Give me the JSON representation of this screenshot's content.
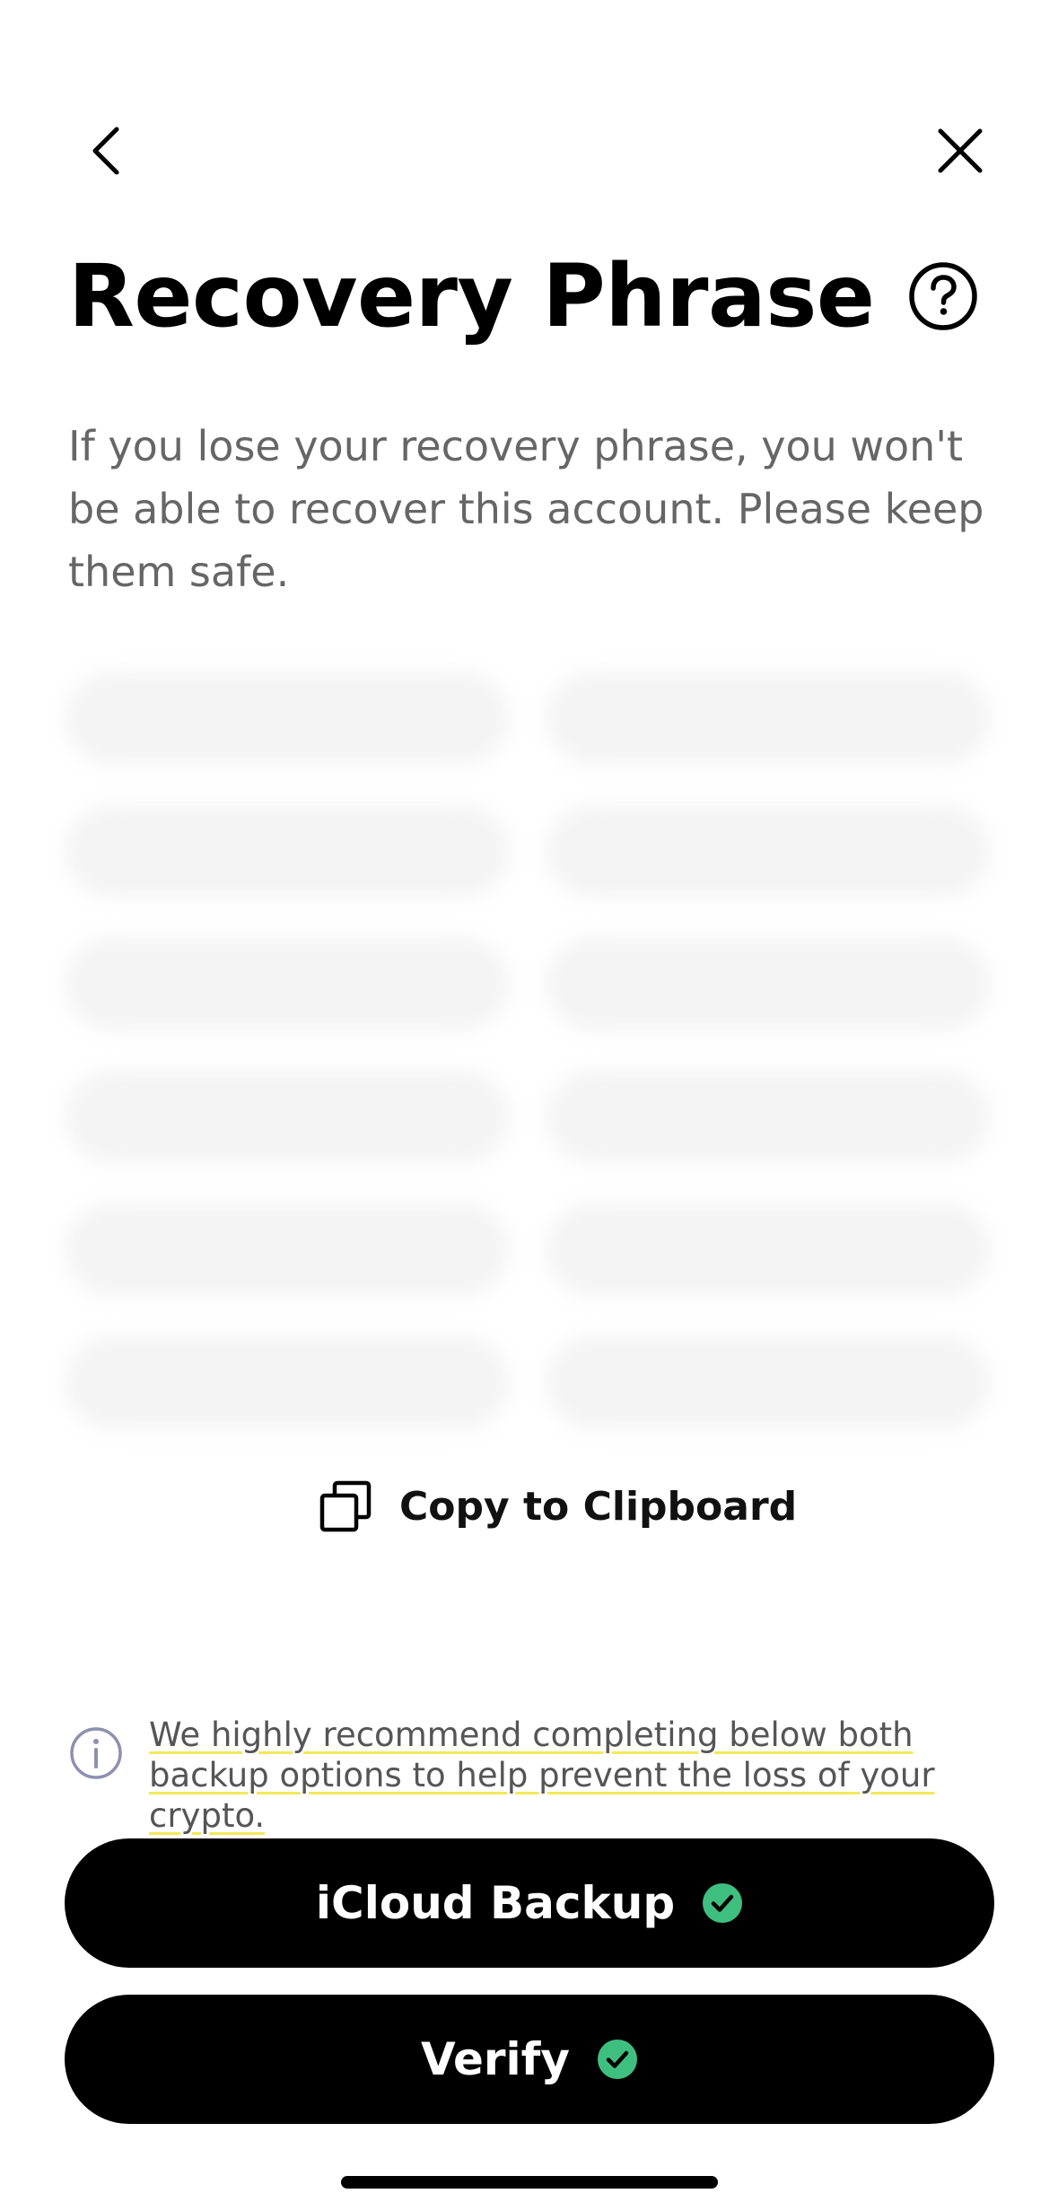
{
  "header": {
    "back_icon": "chevron-left-icon",
    "close_icon": "close-icon",
    "title": "Recovery Phrase",
    "help_icon": "question-circle-icon"
  },
  "subtitle": "If you lose your recovery phrase, you won't be able to recover this account. Please keep them safe.",
  "phrase": {
    "blurred": true,
    "words": [
      "",
      "",
      "",
      "",
      "",
      "",
      "",
      "",
      "",
      "",
      "",
      ""
    ]
  },
  "copy": {
    "label": "Copy to Clipboard",
    "icon": "copy-icon"
  },
  "info": {
    "icon": "info-icon",
    "text": "We highly recommend completing below both backup options to help prevent the loss of your crypto."
  },
  "actions": {
    "icloud_label": "iCloud Backup",
    "verify_label": "Verify",
    "check_color": "#3fbf7f"
  },
  "colors": {
    "primary_button": "#000000",
    "subtitle_text": "#666666",
    "info_underline": "#f2e85a"
  }
}
